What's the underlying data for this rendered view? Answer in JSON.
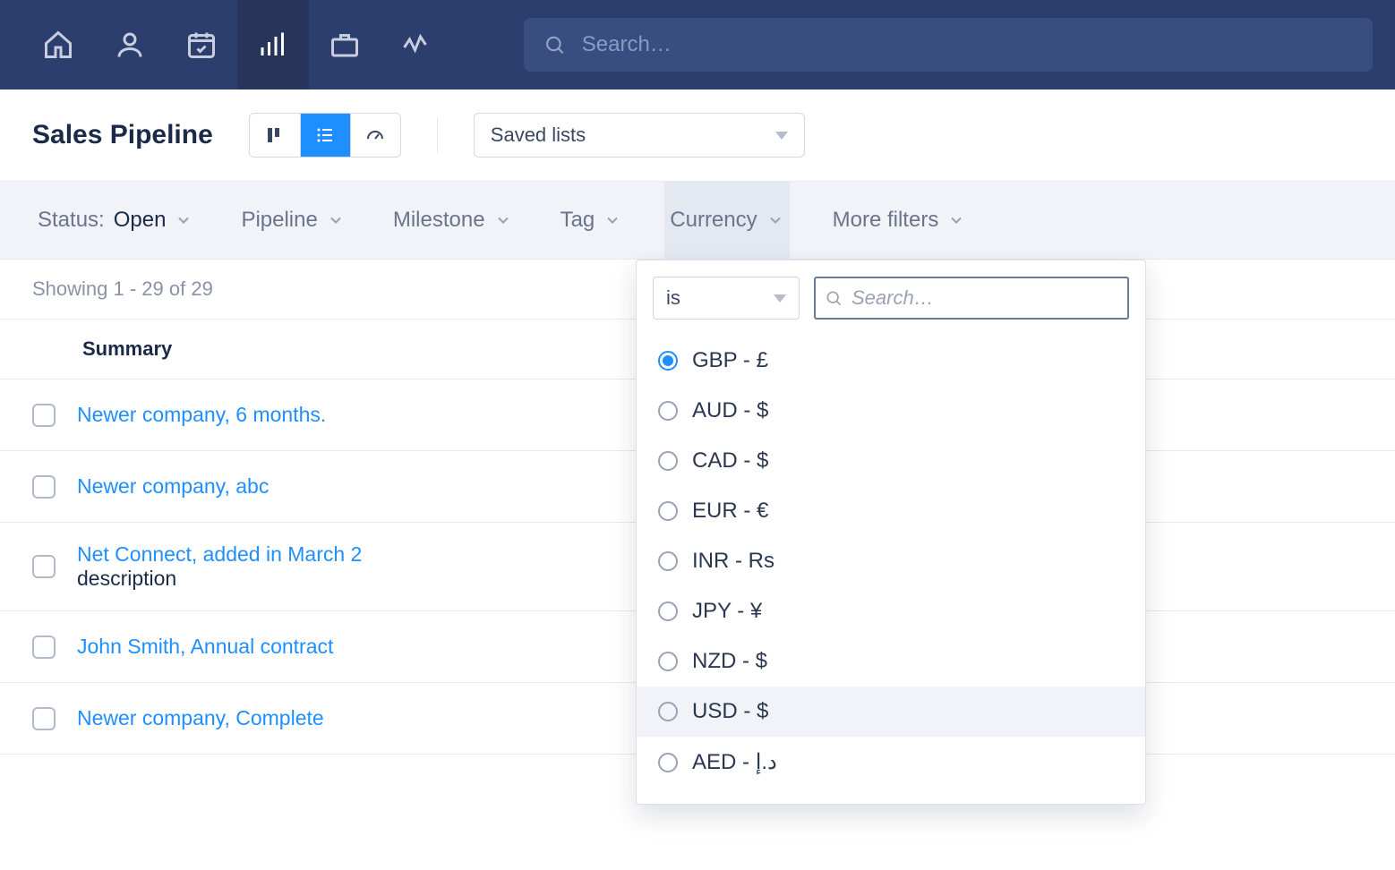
{
  "topbar": {
    "search_placeholder": "Search…"
  },
  "header": {
    "title": "Sales Pipeline",
    "savedlists_label": "Saved lists"
  },
  "filters": {
    "status_label": "Status:",
    "status_value": "Open",
    "pipeline": "Pipeline",
    "milestone": "Milestone",
    "tag": "Tag",
    "currency": "Currency",
    "more": "More filters"
  },
  "results": {
    "showing": "Showing 1 - 29 of 29",
    "summary_col": "Summary"
  },
  "rows": [
    {
      "title": "Newer company, 6 months.",
      "desc": ""
    },
    {
      "title": "Newer company, abc",
      "desc": ""
    },
    {
      "title": "Net Connect, added in March 2",
      "desc": "description"
    },
    {
      "title": "John Smith, Annual contract",
      "desc": ""
    },
    {
      "title": "Newer company, Complete",
      "desc": ""
    }
  ],
  "popover": {
    "operator": "is",
    "search_placeholder": "Search…",
    "options": [
      {
        "label": "GBP - £",
        "selected": true
      },
      {
        "label": "AUD - $",
        "selected": false
      },
      {
        "label": "CAD - $",
        "selected": false
      },
      {
        "label": "EUR - €",
        "selected": false
      },
      {
        "label": "INR - Rs",
        "selected": false
      },
      {
        "label": "JPY - ¥",
        "selected": false
      },
      {
        "label": "NZD - $",
        "selected": false
      },
      {
        "label": "USD - $",
        "selected": false,
        "hovered": true
      },
      {
        "label": "AED - د.إ",
        "selected": false
      }
    ]
  }
}
